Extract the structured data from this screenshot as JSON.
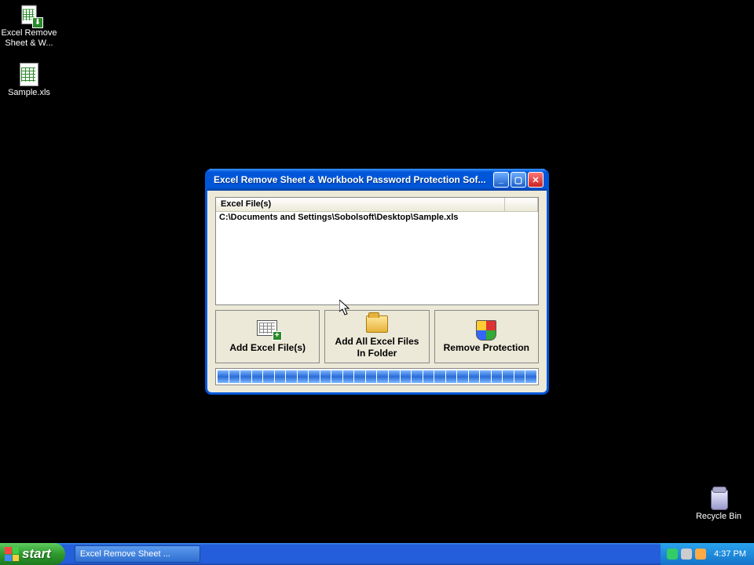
{
  "desktop": {
    "icons": {
      "app": "Excel Remove Sheet & W...",
      "sample": "Sample.xls",
      "recycle": "Recycle Bin"
    }
  },
  "window": {
    "title": "Excel Remove Sheet & Workbook Password Protection Sof...",
    "list_header": "Excel File(s)",
    "files": [
      "C:\\Documents and Settings\\Sobolsoft\\Desktop\\Sample.xls"
    ],
    "buttons": {
      "add": "Add Excel File(s)",
      "add_folder_l1": "Add All Excel Files",
      "add_folder_l2": "In Folder",
      "remove": "Remove Protection"
    }
  },
  "taskbar": {
    "start": "start",
    "task": "Excel Remove Sheet ...",
    "clock": "4:37 PM"
  }
}
